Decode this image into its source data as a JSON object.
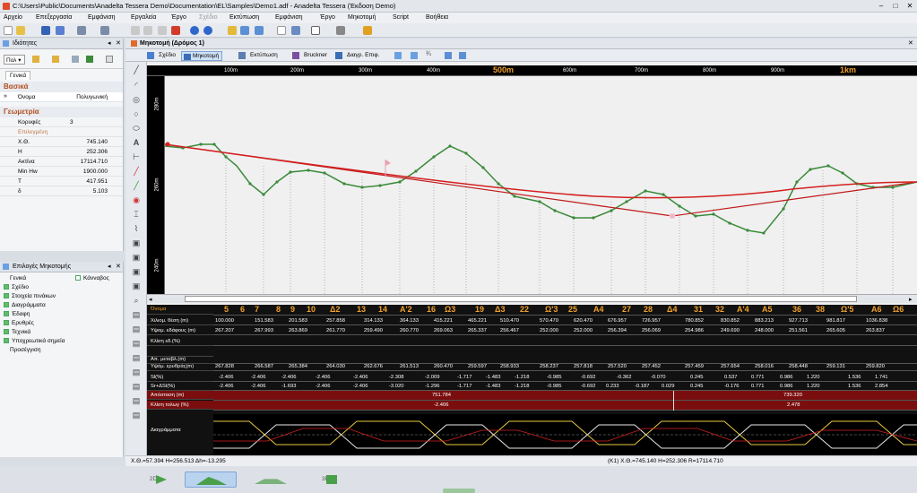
{
  "window": {
    "title": "C:\\Users\\Public\\Documents\\Anadelta Tessera Demo\\Documentation\\EL\\Samples\\Demo1.adf - Anadelta Tessera (Έκδοση Demo)"
  },
  "menu": [
    "Αρχείο",
    "Επεξεργασία",
    "Εμφάνιση",
    "Εργαλεία",
    "Έργο",
    "Σχέδιο",
    "Εκτύπωση",
    "Εμφάνιση",
    "Έργο",
    "Μηκοτομή",
    "Script",
    "Βοήθεια"
  ],
  "props": {
    "title": "Ιδιότητες",
    "combo": "Πολ",
    "tab": "Γενικά",
    "group_basic": "Βασικά",
    "name_key": "Όνομα",
    "name_val": "Πολυγωνική",
    "group_geom": "Γεωμετρία",
    "rows": [
      {
        "k": "Κορυφές",
        "v": "3"
      },
      {
        "k": "Επιλεγμένη",
        "v": ""
      },
      {
        "k": "Χ.Θ.",
        "v": "745.140"
      },
      {
        "k": "Η",
        "v": "252.306"
      },
      {
        "k": "Ακτίνα",
        "v": "17114.710"
      },
      {
        "k": "Min Hw",
        "v": "1900.000"
      },
      {
        "k": "T",
        "v": "417.951"
      },
      {
        "k": "δ",
        "v": "5.103"
      }
    ]
  },
  "options": {
    "title": "Επιλογές Μηκοτομής",
    "items": [
      "Γενικά",
      "Σχέδιο",
      "Στοιχεία πινάκων",
      "Διαγράμματα",
      "Έδαφη",
      "Ερυθρές",
      "Τεχνικά",
      "Υποχρεωτικά σημεία",
      "Προσέγγιση"
    ],
    "extra": "Κάνναβος"
  },
  "main": {
    "title": "Μηκοτομή (Δρόμος 1)",
    "subtabs": [
      "Σχέδιο",
      "Μηκοτομή",
      "Εκτύπωση",
      "Bruckner",
      "Διαγρ. Επιφ."
    ]
  },
  "plot": {
    "ruler": [
      "100m",
      "200m",
      "300m",
      "400m",
      "500m",
      "600m",
      "700m",
      "800m",
      "900m",
      "1km"
    ],
    "yaxis": [
      "280m",
      "260m",
      "240m"
    ],
    "colors": {
      "ground": "#3a8a3a",
      "red": "#d42020",
      "bg": "#000000",
      "ruler_major": "#f2a12a"
    }
  },
  "table": {
    "headers": [
      "5",
      "6",
      "7",
      "8",
      "9",
      "10",
      "Δ2",
      "13",
      "14",
      "Α'2",
      "16",
      "Ω3",
      "19",
      "Δ3",
      "22",
      "Ω'3",
      "25",
      "Α4",
      "27",
      "28",
      "Δ4",
      "31",
      "32",
      "Α'4",
      "Α5",
      "36",
      "38",
      "Ω'5",
      "Α6",
      "Ω6"
    ],
    "labels": [
      "Όνομα",
      "Χιλιομ. θέση (m)",
      "Υψομ. εδάφους (m)",
      "Κλίση εδ.(%)",
      "",
      "Απ. μεταβλ.(m)",
      "Υψόμ. ερυθράς(m)",
      "Sl(%)",
      "Sr+ΔSl(%)",
      "Απόσταση (m)",
      "Κλίση τολωγ (%)",
      "Διαγράμματα"
    ],
    "km": [
      "100.000",
      "151.583",
      "201.583",
      "257.858",
      "314.133",
      "364.133",
      "415.221",
      "465.221",
      "510.470",
      "570.470",
      "620.470",
      "676.957",
      "726.957",
      "780.852",
      "830.852",
      "883.213",
      "927.713",
      "981.817",
      "1036.838"
    ],
    "ground": [
      "267.207",
      "267.993",
      "263.869",
      "261.770",
      "259.490",
      "260.770",
      "269.063",
      "265.337",
      "256.467",
      "252.000",
      "252.000",
      "256.394",
      "256.069",
      "254.986",
      "249.690",
      "248.000",
      "251.561",
      "265.605",
      "263.837"
    ],
    "red": [
      "267.828",
      "266.587",
      "265.384",
      "264.030",
      "262.676",
      "261.513",
      "260.470",
      "259.597",
      "258.933",
      "258.237",
      "257.818",
      "257.520",
      "257.452",
      "257.459",
      "257.654",
      "258.016",
      "258.448",
      "259.131",
      "259.820"
    ],
    "sl": [
      "-2.406",
      "-2.406",
      "-2.406",
      "-2.406",
      "-2.406",
      "-2.308",
      "-2.009",
      "-1.717",
      "-1.483",
      "-1.218",
      "-0.985",
      "-0.692",
      "-0.362",
      "-0.070",
      "0.245",
      "0.537",
      "0.771",
      "0.986",
      "1.220",
      "1.536",
      "1.741"
    ],
    "sr": [
      "-2.406",
      "-2.406",
      "-1.693",
      "-2.406",
      "-2.406",
      "-3.020",
      "-1.296",
      "-1.717",
      "-1.483",
      "-1.218",
      "-0.985",
      "-0.692",
      "0.233",
      "-0.187",
      "0.029",
      "0.245",
      "-0.176",
      "0.771",
      "0.986",
      "1.220",
      "1.536",
      "2.854"
    ],
    "dist": [
      "751.784",
      "739.320"
    ],
    "slope": [
      "-2.406",
      "2.478"
    ]
  },
  "status": {
    "left": "Χ.Θ.=57.394  Η=256.513  Δh=-13.295",
    "right": "(K1)  Χ.Θ.=745.140  Η=252.306  R=17114.710"
  },
  "bottom": [
    "2D",
    "",
    "",
    "3D"
  ]
}
